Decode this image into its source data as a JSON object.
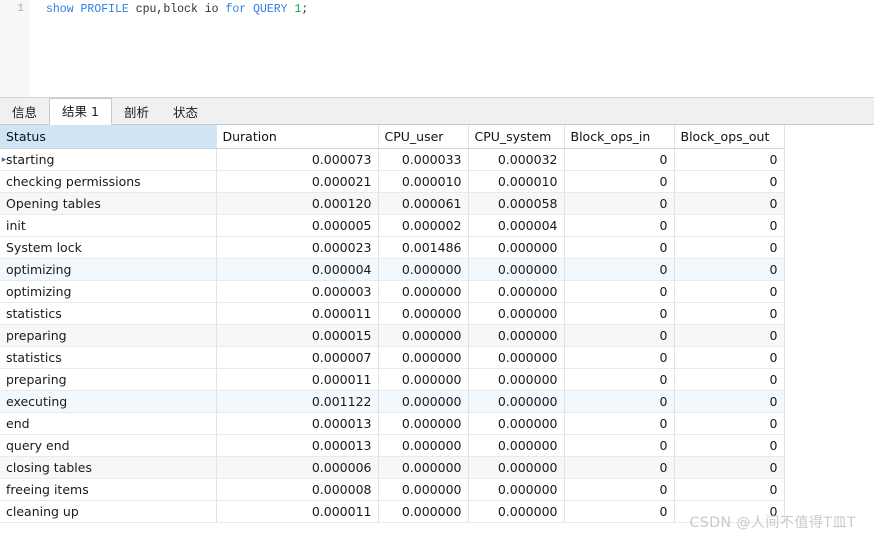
{
  "editor": {
    "line_number": "1",
    "sql_tokens": [
      {
        "text": "show",
        "type": "keyword"
      },
      {
        "text": " ",
        "type": "plain"
      },
      {
        "text": "PROFILE",
        "type": "keyword"
      },
      {
        "text": " cpu,block io ",
        "type": "plain"
      },
      {
        "text": "for",
        "type": "keyword"
      },
      {
        "text": " ",
        "type": "plain"
      },
      {
        "text": "QUERY",
        "type": "keyword"
      },
      {
        "text": " ",
        "type": "plain"
      },
      {
        "text": "1",
        "type": "number"
      },
      {
        "text": ";",
        "type": "punctuation"
      }
    ],
    "sql_full": "show PROFILE cpu,block io for QUERY 1;"
  },
  "tabs": [
    {
      "label": "信息",
      "active": false
    },
    {
      "label": "结果 1",
      "active": true
    },
    {
      "label": "剖析",
      "active": false
    },
    {
      "label": "状态",
      "active": false
    }
  ],
  "grid": {
    "columns": [
      {
        "key": "status",
        "label": "Status",
        "align": "left",
        "selected": true
      },
      {
        "key": "duration",
        "label": "Duration",
        "align": "right",
        "selected": false
      },
      {
        "key": "cpu_user",
        "label": "CPU_user",
        "align": "right",
        "selected": false
      },
      {
        "key": "cpu_system",
        "label": "CPU_system",
        "align": "right",
        "selected": false
      },
      {
        "key": "block_ops_in",
        "label": "Block_ops_in",
        "align": "right",
        "selected": false
      },
      {
        "key": "block_ops_out",
        "label": "Block_ops_out",
        "align": "right",
        "selected": false
      }
    ],
    "current_row_marker": "▸",
    "rows": [
      {
        "status": "starting",
        "duration": "0.000073",
        "cpu_user": "0.000033",
        "cpu_system": "0.000032",
        "block_ops_in": "0",
        "block_ops_out": "0"
      },
      {
        "status": "checking permissions",
        "duration": "0.000021",
        "cpu_user": "0.000010",
        "cpu_system": "0.000010",
        "block_ops_in": "0",
        "block_ops_out": "0"
      },
      {
        "status": "Opening tables",
        "duration": "0.000120",
        "cpu_user": "0.000061",
        "cpu_system": "0.000058",
        "block_ops_in": "0",
        "block_ops_out": "0"
      },
      {
        "status": "init",
        "duration": "0.000005",
        "cpu_user": "0.000002",
        "cpu_system": "0.000004",
        "block_ops_in": "0",
        "block_ops_out": "0"
      },
      {
        "status": "System lock",
        "duration": "0.000023",
        "cpu_user": "0.001486",
        "cpu_system": "0.000000",
        "block_ops_in": "0",
        "block_ops_out": "0"
      },
      {
        "status": "optimizing",
        "duration": "0.000004",
        "cpu_user": "0.000000",
        "cpu_system": "0.000000",
        "block_ops_in": "0",
        "block_ops_out": "0"
      },
      {
        "status": "optimizing",
        "duration": "0.000003",
        "cpu_user": "0.000000",
        "cpu_system": "0.000000",
        "block_ops_in": "0",
        "block_ops_out": "0"
      },
      {
        "status": "statistics",
        "duration": "0.000011",
        "cpu_user": "0.000000",
        "cpu_system": "0.000000",
        "block_ops_in": "0",
        "block_ops_out": "0"
      },
      {
        "status": "preparing",
        "duration": "0.000015",
        "cpu_user": "0.000000",
        "cpu_system": "0.000000",
        "block_ops_in": "0",
        "block_ops_out": "0"
      },
      {
        "status": "statistics",
        "duration": "0.000007",
        "cpu_user": "0.000000",
        "cpu_system": "0.000000",
        "block_ops_in": "0",
        "block_ops_out": "0"
      },
      {
        "status": "preparing",
        "duration": "0.000011",
        "cpu_user": "0.000000",
        "cpu_system": "0.000000",
        "block_ops_in": "0",
        "block_ops_out": "0"
      },
      {
        "status": "executing",
        "duration": "0.001122",
        "cpu_user": "0.000000",
        "cpu_system": "0.000000",
        "block_ops_in": "0",
        "block_ops_out": "0"
      },
      {
        "status": "end",
        "duration": "0.000013",
        "cpu_user": "0.000000",
        "cpu_system": "0.000000",
        "block_ops_in": "0",
        "block_ops_out": "0"
      },
      {
        "status": "query end",
        "duration": "0.000013",
        "cpu_user": "0.000000",
        "cpu_system": "0.000000",
        "block_ops_in": "0",
        "block_ops_out": "0"
      },
      {
        "status": "closing tables",
        "duration": "0.000006",
        "cpu_user": "0.000000",
        "cpu_system": "0.000000",
        "block_ops_in": "0",
        "block_ops_out": "0"
      },
      {
        "status": "freeing items",
        "duration": "0.000008",
        "cpu_user": "0.000000",
        "cpu_system": "0.000000",
        "block_ops_in": "0",
        "block_ops_out": "0"
      },
      {
        "status": "cleaning up",
        "duration": "0.000011",
        "cpu_user": "0.000000",
        "cpu_system": "0.000000",
        "block_ops_in": "0",
        "block_ops_out": "0"
      }
    ]
  },
  "watermark": {
    "text": "CSDN @人间不值得T皿T"
  },
  "colors": {
    "keyword": "#2f7fe8",
    "number": "#11a642",
    "selected_header": "#cfe4f5",
    "stripe_grey": "#f7f7f7",
    "stripe_blue": "#f3f8fd",
    "gutter": "#f7f7f7",
    "tabbar": "#f0f0f0"
  }
}
